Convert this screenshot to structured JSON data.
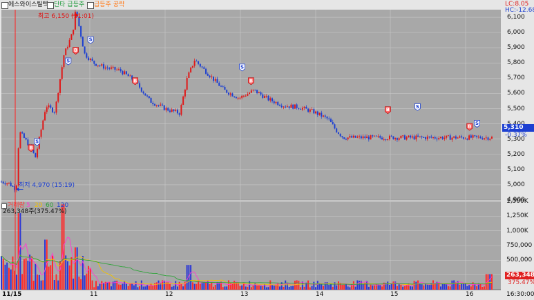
{
  "header": {
    "stock_name": "에스와이스틸텍",
    "legend": [
      {
        "label": "단타 급등주",
        "color": "#1f9a3c"
      },
      {
        "label": "급등주 공략",
        "color": "#ff7a1a"
      }
    ],
    "lc": "LC:8.05",
    "hc": "HC:-12.68"
  },
  "annotations": {
    "high": "최고 6,150 (11:01)",
    "low": "최저 4,970 (15:19)"
  },
  "price_axis": {
    "ticks": [
      "6,100",
      "6,000",
      "5,900",
      "5,800",
      "5,700",
      "5,600",
      "5,500",
      "5,400",
      "5,300",
      "5,200",
      "5,100",
      "5,000",
      "4,900"
    ],
    "current_price": "5,310",
    "current_change": "-0.37%"
  },
  "volume_pane": {
    "legend_label": "거래량",
    "legend_ma": [
      "5",
      "20",
      "60",
      "120"
    ],
    "legend_colors": [
      "#ff3b3b",
      "#ff3bd0",
      "#f2c200",
      "#2fa43a",
      "#1c3fd1"
    ],
    "summary": "263,348주(375.47%)",
    "ticks": [
      "1,500K",
      "1,250K",
      "1,000K",
      "750,000",
      "500,000",
      "250,000"
    ],
    "current_volume": "263,348",
    "current_pct": "375.47%"
  },
  "time_axis": {
    "labels": [
      "11/15",
      "11",
      "12",
      "13",
      "14",
      "15",
      "16"
    ],
    "end_label": "16:30:00"
  },
  "chart_data": {
    "type": "candlestick",
    "price_ylim": [
      4900,
      6150
    ],
    "x_sessions": [
      "11/15 (end)",
      "11",
      "12",
      "13",
      "14",
      "15",
      "16"
    ],
    "price_path": [
      {
        "t": 0.0,
        "p": 5020
      },
      {
        "t": 0.5,
        "p": 5010
      },
      {
        "t": 1.0,
        "p": 4970
      },
      {
        "t": 1.2,
        "p": 5350
      },
      {
        "t": 1.8,
        "p": 5270
      },
      {
        "t": 2.3,
        "p": 5180
      },
      {
        "t": 3.0,
        "p": 5520
      },
      {
        "t": 3.6,
        "p": 5480
      },
      {
        "t": 4.2,
        "p": 5850
      },
      {
        "t": 4.8,
        "p": 6000
      },
      {
        "t": 5.0,
        "p": 6150
      },
      {
        "t": 5.6,
        "p": 5860
      },
      {
        "t": 6.2,
        "p": 5800
      },
      {
        "t": 7.0,
        "p": 5770
      },
      {
        "t": 8.0,
        "p": 5750
      },
      {
        "t": 9.0,
        "p": 5680
      },
      {
        "t": 10.0,
        "p": 5550
      },
      {
        "t": 11.0,
        "p": 5500
      },
      {
        "t": 12.0,
        "p": 5470
      },
      {
        "t": 12.5,
        "p": 5700
      },
      {
        "t": 13.0,
        "p": 5820
      },
      {
        "t": 14.0,
        "p": 5720
      },
      {
        "t": 15.0,
        "p": 5620
      },
      {
        "t": 16.0,
        "p": 5570
      },
      {
        "t": 17.0,
        "p": 5620
      },
      {
        "t": 18.0,
        "p": 5560
      },
      {
        "t": 19.0,
        "p": 5520
      },
      {
        "t": 20.0,
        "p": 5510
      },
      {
        "t": 21.0,
        "p": 5480
      },
      {
        "t": 22.0,
        "p": 5430
      },
      {
        "t": 22.5,
        "p": 5360
      },
      {
        "t": 23.0,
        "p": 5310
      }
    ],
    "volume_ylim": [
      0,
      1500000
    ],
    "high": {
      "price": 6150,
      "time": "11:01"
    },
    "low": {
      "price": 4970,
      "time": "15:19"
    },
    "signals": [
      {
        "type": "B",
        "t": 2.0,
        "p": 5240
      },
      {
        "type": "S",
        "t": 2.4,
        "p": 5280
      },
      {
        "type": "S",
        "t": 4.5,
        "p": 5810
      },
      {
        "type": "B",
        "t": 5.0,
        "p": 5880
      },
      {
        "type": "S",
        "t": 6.0,
        "p": 5950
      },
      {
        "type": "B",
        "t": 9.0,
        "p": 5680
      },
      {
        "type": "S",
        "t": 16.2,
        "p": 5770
      },
      {
        "type": "B",
        "t": 16.8,
        "p": 5680
      },
      {
        "type": "B",
        "t": 26.0,
        "p": 5490
      },
      {
        "type": "S",
        "t": 28.0,
        "p": 5510
      },
      {
        "type": "B",
        "t": 31.5,
        "p": 5380
      },
      {
        "type": "S",
        "t": 32.0,
        "p": 5400
      }
    ]
  }
}
